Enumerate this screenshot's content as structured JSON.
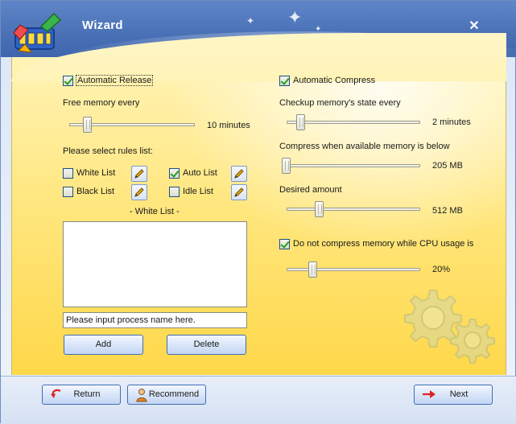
{
  "window": {
    "title": "Wizard",
    "close_glyph": "✕"
  },
  "left": {
    "auto_release": {
      "label": "Automatic Release",
      "checked": true
    },
    "free_memory": {
      "label": "Free memory every",
      "value": "10 minutes",
      "slider_fraction": 0.15
    },
    "rules_label": "Please select rules list:",
    "rules": [
      {
        "label": "White List",
        "checked": false
      },
      {
        "label": "Auto List",
        "checked": true
      },
      {
        "label": "Black List",
        "checked": false
      },
      {
        "label": "Idle List",
        "checked": false
      }
    ],
    "list_title": "- White List -",
    "process_input": {
      "value": "Please input process name here."
    },
    "add_label": "Add",
    "delete_label": "Delete"
  },
  "right": {
    "auto_compress": {
      "label": "Automatic Compress",
      "checked": true
    },
    "checkup": {
      "label": "Checkup memory's state every",
      "value": "2 minutes",
      "slider_fraction": 0.1
    },
    "compress_when": {
      "label": "Compress when available memory is below",
      "value": "205 MB",
      "slider_fraction": 0.0
    },
    "desired": {
      "label": "Desired amount",
      "value": "512 MB",
      "slider_fraction": 0.25
    },
    "cpu": {
      "label": "Do not compress memory while CPU usage is",
      "checked": true,
      "value": "20%",
      "slider_fraction": 0.2
    }
  },
  "footer": {
    "return_label": "Return",
    "recommend_label": "Recommend",
    "next_label": "Next"
  },
  "icons": {
    "logo": "app-logo",
    "pencil": "pencil-icon",
    "return": "return-arrow-icon",
    "recommend": "person-icon",
    "next": "next-arrow-icon",
    "gears": "gears-watermark"
  },
  "colors": {
    "accent_blue": "#4b72b7",
    "panel_yellow": "#ffe780"
  }
}
